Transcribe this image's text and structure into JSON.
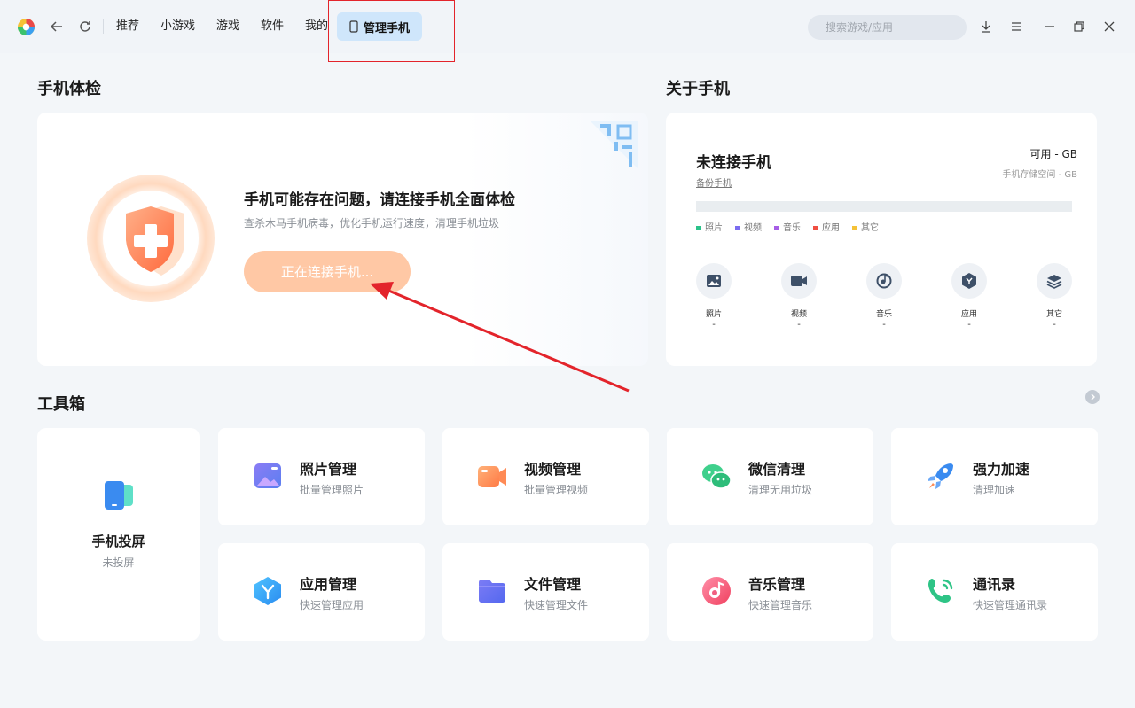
{
  "nav": {
    "items": [
      "推荐",
      "小游戏",
      "游戏",
      "软件",
      "我的"
    ],
    "active_label": "管理手机"
  },
  "search": {
    "placeholder": "搜索游戏/应用"
  },
  "check": {
    "section_title": "手机体检",
    "title": "手机可能存在问题，请连接手机全面体检",
    "subtitle": "查杀木马手机病毒，优化手机运行速度，清理手机垃圾",
    "button_label": "正在连接手机..."
  },
  "about": {
    "section_title": "关于手机",
    "status": "未连接手机",
    "backup_link": "备份手机",
    "available": "可用 - GB",
    "storage_label": "手机存储空间 - GB",
    "legend": [
      {
        "label": "照片",
        "color": "#2bc28a"
      },
      {
        "label": "视频",
        "color": "#7b6cf0"
      },
      {
        "label": "音乐",
        "color": "#a65ee6"
      },
      {
        "label": "应用",
        "color": "#f04f42"
      },
      {
        "label": "其它",
        "color": "#f5c237"
      }
    ],
    "categories": [
      {
        "label": "照片",
        "value": "-",
        "icon": "photo-icon"
      },
      {
        "label": "视频",
        "value": "-",
        "icon": "video-icon"
      },
      {
        "label": "音乐",
        "value": "-",
        "icon": "music-icon"
      },
      {
        "label": "应用",
        "value": "-",
        "icon": "app-icon"
      },
      {
        "label": "其它",
        "value": "-",
        "icon": "layers-icon"
      }
    ]
  },
  "toolbox": {
    "section_title": "工具箱",
    "cast": {
      "name": "手机投屏",
      "status": "未投屏"
    },
    "tools": [
      {
        "name": "照片管理",
        "desc": "批量管理照片",
        "icon": "photo-manage-icon"
      },
      {
        "name": "视频管理",
        "desc": "批量管理视频",
        "icon": "video-manage-icon"
      },
      {
        "name": "微信清理",
        "desc": "清理无用垃圾",
        "icon": "wechat-icon"
      },
      {
        "name": "强力加速",
        "desc": "清理加速",
        "icon": "rocket-icon"
      },
      {
        "name": "应用管理",
        "desc": "快速管理应用",
        "icon": "app-manage-icon"
      },
      {
        "name": "文件管理",
        "desc": "快速管理文件",
        "icon": "folder-icon"
      },
      {
        "name": "音乐管理",
        "desc": "快速管理音乐",
        "icon": "music-manage-icon"
      },
      {
        "name": "通讯录",
        "desc": "快速管理通讯录",
        "icon": "contacts-icon"
      }
    ]
  }
}
